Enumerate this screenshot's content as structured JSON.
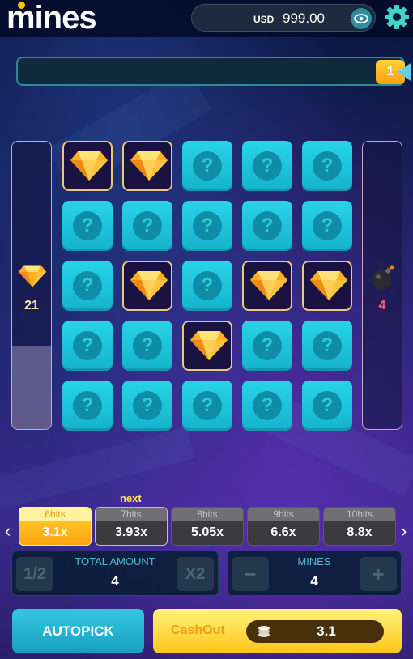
{
  "header": {
    "logo_text": "mines",
    "currency": "USD",
    "balance": "999.00",
    "visibility_icon": "eye-icon",
    "settings_icon": "gear-icon"
  },
  "progress": {
    "badge": "1"
  },
  "gems_panel": {
    "icon": "gem-icon",
    "count": "21",
    "fill_fraction": 0.29
  },
  "mines_panel": {
    "icon": "bomb-icon",
    "count": "4"
  },
  "grid": {
    "rows": 5,
    "cols": 5,
    "hidden_symbol": "?",
    "tiles": [
      [
        "gem",
        "gem",
        "hidden",
        "hidden",
        "hidden"
      ],
      [
        "hidden",
        "hidden",
        "hidden",
        "hidden",
        "hidden"
      ],
      [
        "hidden",
        "gem",
        "hidden",
        "gem",
        "gem"
      ],
      [
        "hidden",
        "hidden",
        "gem",
        "hidden",
        "hidden"
      ],
      [
        "hidden",
        "hidden",
        "hidden",
        "hidden",
        "hidden"
      ]
    ]
  },
  "multipliers": {
    "next_label": "next",
    "prev_arrow": "‹",
    "next_arrow": "›",
    "items": [
      {
        "hits": "6hits",
        "value": "3.1x",
        "state": "active"
      },
      {
        "hits": "7hits",
        "value": "3.93x",
        "state": "next"
      },
      {
        "hits": "8hits",
        "value": "5.05x",
        "state": "normal"
      },
      {
        "hits": "9hits",
        "value": "6.6x",
        "state": "normal"
      },
      {
        "hits": "10hits",
        "value": "8.8x",
        "state": "normal"
      }
    ]
  },
  "bet": {
    "half_label": "1/2",
    "double_label": "X2",
    "label": "TOTAL AMOUNT",
    "value": "4"
  },
  "mines_control": {
    "minus_label": "−",
    "plus_label": "+",
    "label": "MINES",
    "value": "4"
  },
  "actions": {
    "autopick_label": "AUTOPICK",
    "cashout_label": "CashOut",
    "cashout_value": "3.1"
  },
  "colors": {
    "accent_cyan": "#28d4e8",
    "gold": "#ffc51b",
    "gem_border": "#e8c87a"
  }
}
